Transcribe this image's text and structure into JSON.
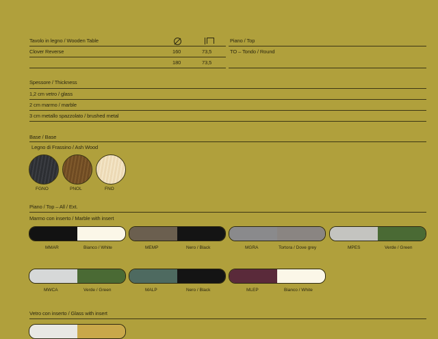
{
  "table": {
    "header": "Tavolo in legno / Wooden Table",
    "row1": {
      "name": "Clover Reverse",
      "d": "160",
      "h": "73,5"
    },
    "row2": {
      "d": "180",
      "h": "73,5"
    }
  },
  "top": {
    "header": "Piano / Top",
    "value": "TO – Tondo / Round"
  },
  "thickness": {
    "header": "Spessore / Thickness",
    "items": [
      "1,2 cm vetro / glass",
      "2 cm marmo / marble",
      "3 cm metallo spazzolato / brushed metal"
    ]
  },
  "base": {
    "header": "Base / Base",
    "sub": "Legno di Frassino / Ash Wood",
    "swatches": [
      {
        "code": "FGNO",
        "color": "#2c2e32"
      },
      {
        "code": "PNOL",
        "color": "#6e4a22"
      },
      {
        "code": "FNO",
        "color": "#ecd9b5"
      }
    ]
  },
  "top_ext": {
    "header": "Piano / Top – All / Ext.",
    "sub": "Marmo con inserto / Marble with insert",
    "pills": [
      {
        "code": "MMAR",
        "insert": "Bianco / White",
        "c1": "#121212",
        "c2": "#fbf7e8"
      },
      {
        "code": "MEMP",
        "insert": "Nero / Black",
        "c1": "#6b5f4f",
        "c2": "#141414"
      },
      {
        "code": "MGRA",
        "insert": "Tortora / Dove grey",
        "c1": "#8a8a8c",
        "c2": "#8a8582"
      },
      {
        "code": "MPES",
        "insert": "Verde / Green",
        "c1": "#c4c4c0",
        "c2": "#4a6a34"
      },
      {
        "code": "MWCA",
        "insert": "Verde / Green",
        "c1": "#d6d8d8",
        "c2": "#4a6a34"
      },
      {
        "code": "MALP",
        "insert": "Nero / Black",
        "c1": "#4e6a60",
        "c2": "#141414"
      },
      {
        "code": "MLEP",
        "insert": "Bianco / White",
        "c1": "#5a2a3a",
        "c2": "#fbf7e8"
      }
    ]
  },
  "glass": {
    "header": "Vetro con inserto / Glass with insert"
  }
}
